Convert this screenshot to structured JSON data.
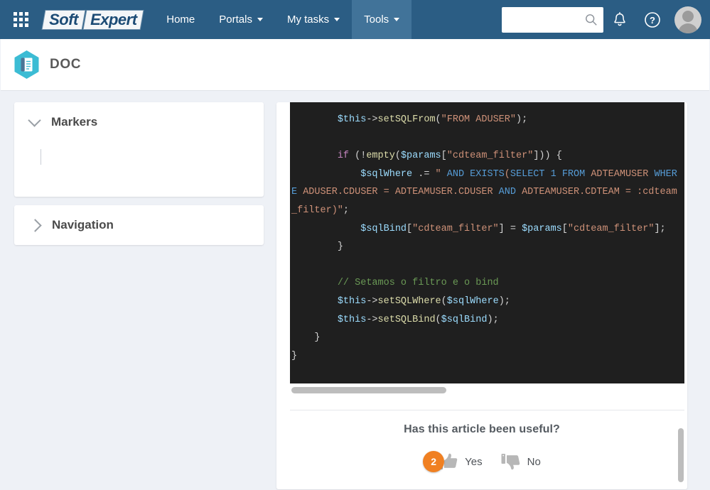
{
  "topbar": {
    "apps_icon": "apps-grid-icon",
    "logo": {
      "part1": "Soft",
      "part2": "Expert"
    },
    "nav": [
      {
        "label": "Home",
        "has_caret": false,
        "active": false
      },
      {
        "label": "Portals",
        "has_caret": true,
        "active": false
      },
      {
        "label": "My tasks",
        "has_caret": true,
        "active": false
      },
      {
        "label": "Tools",
        "has_caret": true,
        "active": true
      }
    ],
    "search": {
      "value": "",
      "placeholder": "",
      "icon": "search-icon"
    },
    "notifications_icon": "bell-icon",
    "help_icon": "question-circle-icon",
    "avatar_icon": "user-avatar-icon",
    "bg_color": "#2b5d84",
    "active_bg_color": "#417399"
  },
  "module": {
    "icon": "document-book-hexagon-icon",
    "icon_color": "#3cbcd4",
    "title": "DOC"
  },
  "sidebar": {
    "panels": [
      {
        "title": "Markers",
        "expanded": true,
        "chevron": "chevron-down-icon"
      },
      {
        "title": "Navigation",
        "expanded": false,
        "chevron": "chevron-right-icon"
      }
    ]
  },
  "article": {
    "code": {
      "background": "#1f1f1f",
      "lines": [
        [
          {
            "t": "        ",
            "c": "pl"
          },
          {
            "t": "$this",
            "c": "var"
          },
          {
            "t": "->",
            "c": "pl"
          },
          {
            "t": "setSQLFrom",
            "c": "fn"
          },
          {
            "t": "(",
            "c": "pl"
          },
          {
            "t": "\"FROM ADUSER\"",
            "c": "str"
          },
          {
            "t": ");",
            "c": "pl"
          }
        ],
        [],
        [
          {
            "t": "        ",
            "c": "pl"
          },
          {
            "t": "if",
            "c": "kw"
          },
          {
            "t": " (!",
            "c": "pl"
          },
          {
            "t": "empty",
            "c": "fn"
          },
          {
            "t": "(",
            "c": "pl"
          },
          {
            "t": "$params",
            "c": "var"
          },
          {
            "t": "[",
            "c": "pl"
          },
          {
            "t": "\"cdteam_filter\"",
            "c": "str"
          },
          {
            "t": "])) {",
            "c": "pl"
          }
        ],
        [
          {
            "t": "            ",
            "c": "pl"
          },
          {
            "t": "$sqlWhere",
            "c": "var"
          },
          {
            "t": " .= ",
            "c": "pl"
          },
          {
            "t": "\" ",
            "c": "str"
          },
          {
            "t": "AND",
            "c": "sql"
          },
          {
            "t": " ",
            "c": "str"
          },
          {
            "t": "EXISTS",
            "c": "sql"
          },
          {
            "t": "(",
            "c": "str"
          },
          {
            "t": "SELECT",
            "c": "sql"
          },
          {
            "t": " ",
            "c": "str"
          },
          {
            "t": "1",
            "c": "sql"
          },
          {
            "t": " ",
            "c": "str"
          },
          {
            "t": "FROM",
            "c": "sql"
          },
          {
            "t": " ADTEAMUSER ",
            "c": "str"
          },
          {
            "t": "WHERE",
            "c": "sql"
          },
          {
            "t": " ADUSER.CDUSER = ADTEAMUSER.CDUSER ",
            "c": "str"
          },
          {
            "t": "AND",
            "c": "sql"
          },
          {
            "t": " ADTEAMUSER.CDTEAM = :cdteam_filter)\"",
            "c": "str"
          },
          {
            "t": ";",
            "c": "pl"
          }
        ],
        [
          {
            "t": "            ",
            "c": "pl"
          },
          {
            "t": "$sqlBind",
            "c": "var"
          },
          {
            "t": "[",
            "c": "pl"
          },
          {
            "t": "\"cdteam_filter\"",
            "c": "str"
          },
          {
            "t": "] = ",
            "c": "pl"
          },
          {
            "t": "$params",
            "c": "var"
          },
          {
            "t": "[",
            "c": "pl"
          },
          {
            "t": "\"cdteam_filter\"",
            "c": "str"
          },
          {
            "t": "];",
            "c": "pl"
          }
        ],
        [
          {
            "t": "        }",
            "c": "pl"
          }
        ],
        [],
        [
          {
            "t": "        ",
            "c": "pl"
          },
          {
            "t": "// Setamos o filtro e o bind",
            "c": "cmt"
          }
        ],
        [
          {
            "t": "        ",
            "c": "pl"
          },
          {
            "t": "$this",
            "c": "var"
          },
          {
            "t": "->",
            "c": "pl"
          },
          {
            "t": "setSQLWhere",
            "c": "fn"
          },
          {
            "t": "(",
            "c": "pl"
          },
          {
            "t": "$sqlWhere",
            "c": "var"
          },
          {
            "t": ");",
            "c": "pl"
          }
        ],
        [
          {
            "t": "        ",
            "c": "pl"
          },
          {
            "t": "$this",
            "c": "var"
          },
          {
            "t": "->",
            "c": "pl"
          },
          {
            "t": "setSQLBind",
            "c": "fn"
          },
          {
            "t": "(",
            "c": "pl"
          },
          {
            "t": "$sqlBind",
            "c": "var"
          },
          {
            "t": ");",
            "c": "pl"
          }
        ],
        [
          {
            "t": "    }",
            "c": "pl"
          }
        ],
        [
          {
            "t": "}",
            "c": "pl"
          }
        ]
      ]
    },
    "feedback": {
      "question": "Has this article been useful?",
      "yes": {
        "label": "Yes",
        "count": "2",
        "icon": "thumbs-up-icon",
        "badge_color": "#f08022"
      },
      "no": {
        "label": "No",
        "icon": "thumbs-down-icon"
      }
    }
  },
  "scrollbars": {
    "code_horizontal": "horizontal-scrollbar",
    "content_vertical": "vertical-scrollbar"
  }
}
